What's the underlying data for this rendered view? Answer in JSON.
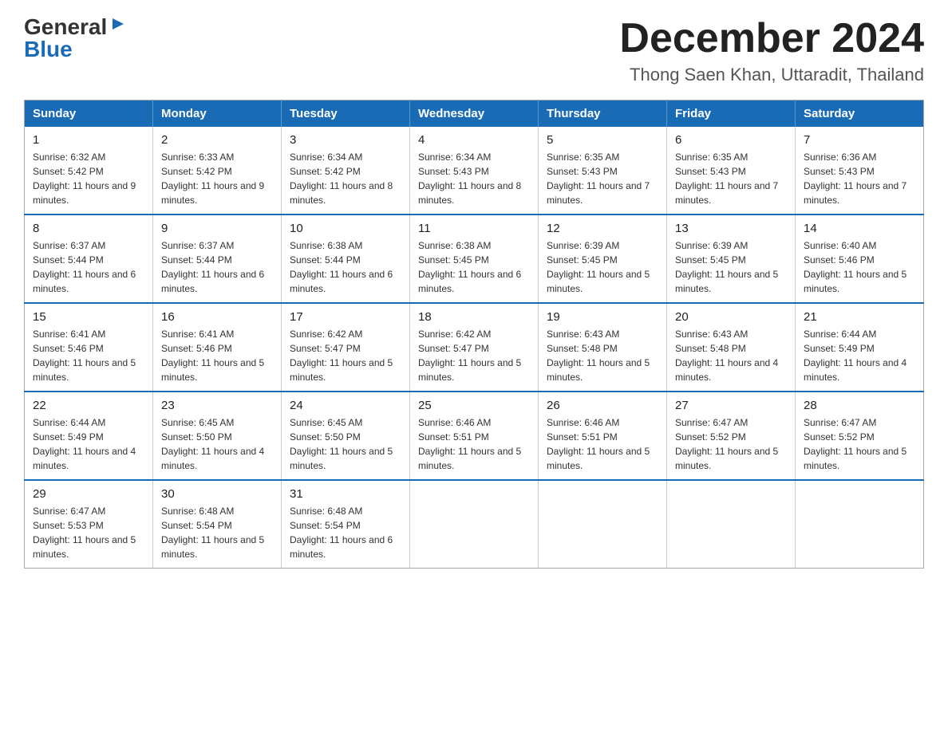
{
  "header": {
    "logo": {
      "general": "General",
      "arrow": "▶",
      "blue": "Blue"
    },
    "title": "December 2024",
    "location": "Thong Saen Khan, Uttaradit, Thailand"
  },
  "weekdays": [
    "Sunday",
    "Monday",
    "Tuesday",
    "Wednesday",
    "Thursday",
    "Friday",
    "Saturday"
  ],
  "weeks": [
    [
      {
        "day": "1",
        "sunrise": "6:32 AM",
        "sunset": "5:42 PM",
        "daylight": "11 hours and 9 minutes."
      },
      {
        "day": "2",
        "sunrise": "6:33 AM",
        "sunset": "5:42 PM",
        "daylight": "11 hours and 9 minutes."
      },
      {
        "day": "3",
        "sunrise": "6:34 AM",
        "sunset": "5:42 PM",
        "daylight": "11 hours and 8 minutes."
      },
      {
        "day": "4",
        "sunrise": "6:34 AM",
        "sunset": "5:43 PM",
        "daylight": "11 hours and 8 minutes."
      },
      {
        "day": "5",
        "sunrise": "6:35 AM",
        "sunset": "5:43 PM",
        "daylight": "11 hours and 7 minutes."
      },
      {
        "day": "6",
        "sunrise": "6:35 AM",
        "sunset": "5:43 PM",
        "daylight": "11 hours and 7 minutes."
      },
      {
        "day": "7",
        "sunrise": "6:36 AM",
        "sunset": "5:43 PM",
        "daylight": "11 hours and 7 minutes."
      }
    ],
    [
      {
        "day": "8",
        "sunrise": "6:37 AM",
        "sunset": "5:44 PM",
        "daylight": "11 hours and 6 minutes."
      },
      {
        "day": "9",
        "sunrise": "6:37 AM",
        "sunset": "5:44 PM",
        "daylight": "11 hours and 6 minutes."
      },
      {
        "day": "10",
        "sunrise": "6:38 AM",
        "sunset": "5:44 PM",
        "daylight": "11 hours and 6 minutes."
      },
      {
        "day": "11",
        "sunrise": "6:38 AM",
        "sunset": "5:45 PM",
        "daylight": "11 hours and 6 minutes."
      },
      {
        "day": "12",
        "sunrise": "6:39 AM",
        "sunset": "5:45 PM",
        "daylight": "11 hours and 5 minutes."
      },
      {
        "day": "13",
        "sunrise": "6:39 AM",
        "sunset": "5:45 PM",
        "daylight": "11 hours and 5 minutes."
      },
      {
        "day": "14",
        "sunrise": "6:40 AM",
        "sunset": "5:46 PM",
        "daylight": "11 hours and 5 minutes."
      }
    ],
    [
      {
        "day": "15",
        "sunrise": "6:41 AM",
        "sunset": "5:46 PM",
        "daylight": "11 hours and 5 minutes."
      },
      {
        "day": "16",
        "sunrise": "6:41 AM",
        "sunset": "5:46 PM",
        "daylight": "11 hours and 5 minutes."
      },
      {
        "day": "17",
        "sunrise": "6:42 AM",
        "sunset": "5:47 PM",
        "daylight": "11 hours and 5 minutes."
      },
      {
        "day": "18",
        "sunrise": "6:42 AM",
        "sunset": "5:47 PM",
        "daylight": "11 hours and 5 minutes."
      },
      {
        "day": "19",
        "sunrise": "6:43 AM",
        "sunset": "5:48 PM",
        "daylight": "11 hours and 5 minutes."
      },
      {
        "day": "20",
        "sunrise": "6:43 AM",
        "sunset": "5:48 PM",
        "daylight": "11 hours and 4 minutes."
      },
      {
        "day": "21",
        "sunrise": "6:44 AM",
        "sunset": "5:49 PM",
        "daylight": "11 hours and 4 minutes."
      }
    ],
    [
      {
        "day": "22",
        "sunrise": "6:44 AM",
        "sunset": "5:49 PM",
        "daylight": "11 hours and 4 minutes."
      },
      {
        "day": "23",
        "sunrise": "6:45 AM",
        "sunset": "5:50 PM",
        "daylight": "11 hours and 4 minutes."
      },
      {
        "day": "24",
        "sunrise": "6:45 AM",
        "sunset": "5:50 PM",
        "daylight": "11 hours and 5 minutes."
      },
      {
        "day": "25",
        "sunrise": "6:46 AM",
        "sunset": "5:51 PM",
        "daylight": "11 hours and 5 minutes."
      },
      {
        "day": "26",
        "sunrise": "6:46 AM",
        "sunset": "5:51 PM",
        "daylight": "11 hours and 5 minutes."
      },
      {
        "day": "27",
        "sunrise": "6:47 AM",
        "sunset": "5:52 PM",
        "daylight": "11 hours and 5 minutes."
      },
      {
        "day": "28",
        "sunrise": "6:47 AM",
        "sunset": "5:52 PM",
        "daylight": "11 hours and 5 minutes."
      }
    ],
    [
      {
        "day": "29",
        "sunrise": "6:47 AM",
        "sunset": "5:53 PM",
        "daylight": "11 hours and 5 minutes."
      },
      {
        "day": "30",
        "sunrise": "6:48 AM",
        "sunset": "5:54 PM",
        "daylight": "11 hours and 5 minutes."
      },
      {
        "day": "31",
        "sunrise": "6:48 AM",
        "sunset": "5:54 PM",
        "daylight": "11 hours and 6 minutes."
      },
      null,
      null,
      null,
      null
    ]
  ]
}
